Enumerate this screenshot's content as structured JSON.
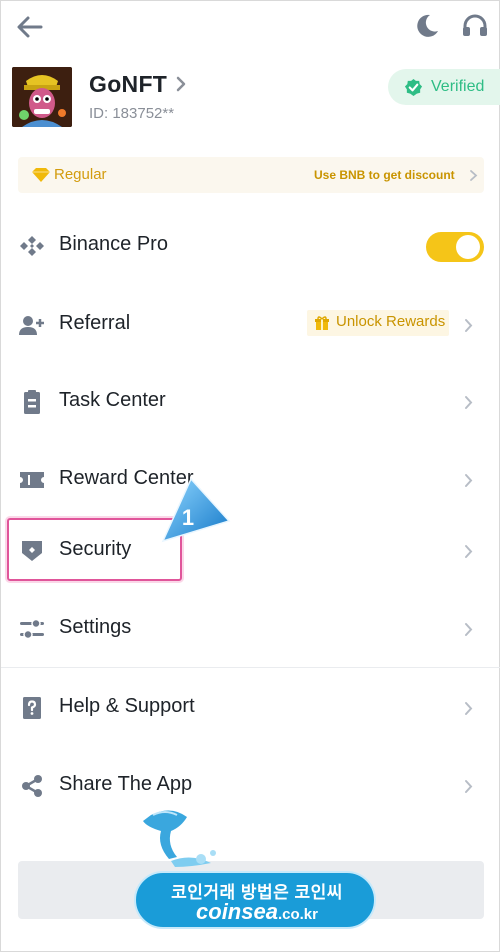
{
  "header": {
    "back_icon": "arrow-left-icon",
    "theme_icon": "moon-icon",
    "support_icon": "headset-icon"
  },
  "profile": {
    "nickname": "GoNFT",
    "uid": "ID: 183752**",
    "verified_label": "Verified",
    "verified_color": "#2ebd85"
  },
  "tier": {
    "name": "Regular",
    "promo": "Use BNB to get discount"
  },
  "menu": {
    "binance_pro": {
      "label": "Binance Pro",
      "toggle_on": true
    },
    "referral": {
      "label": "Referral",
      "badge": "Unlock Rewards"
    },
    "task_center": {
      "label": "Task Center"
    },
    "reward_center": {
      "label": "Reward Center"
    },
    "security": {
      "label": "Security"
    },
    "settings": {
      "label": "Settings"
    },
    "help": {
      "label": "Help & Support"
    },
    "share": {
      "label": "Share The App"
    }
  },
  "annotation": {
    "step_number": "1",
    "highlight_color": "#e0559a"
  },
  "watermark": {
    "korean_text": "코인거래 방법은 코인씨",
    "domain_main": "coinsea",
    "domain_suffix": ".co.kr"
  },
  "colors": {
    "accent": "#f5c518",
    "gold_text": "#c99400",
    "text_primary": "#1e2329",
    "text_secondary": "#8a8f98"
  }
}
